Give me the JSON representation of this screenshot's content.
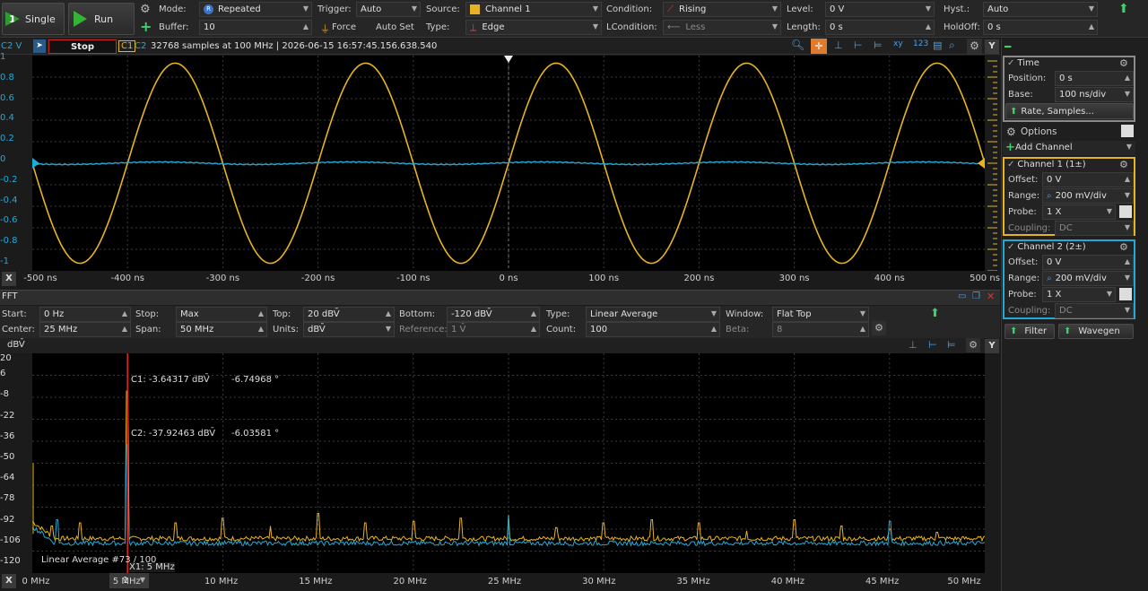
{
  "toolbar": {
    "single_label": "Single",
    "single_badge": "1",
    "run_label": "Run",
    "mode_label": "Mode:",
    "mode_value": "Repeated",
    "buffer_label": "Buffer:",
    "buffer_value": "10",
    "trigger_label": "Trigger:",
    "trigger_value": "Auto",
    "force_label": "Force",
    "autoset_label": "Auto Set",
    "source_label": "Source:",
    "source_value": "Channel 1",
    "type_label": "Type:",
    "type_value": "Edge",
    "condition_label": "Condition:",
    "condition_value": "Rising",
    "lcondition_label": "LCondition:",
    "lcondition_value": "Less",
    "level_label": "Level:",
    "level_value": "0 V",
    "length_label": "Length:",
    "length_value": "0 s",
    "hyst_label": "Hyst.:",
    "hyst_value": "Auto",
    "holdoff_label": "HoldOff:",
    "holdoff_value": "0 s"
  },
  "scope": {
    "channel_axis_label": "C2 V",
    "status": "Stop",
    "c1_tag": "C1",
    "c2_tag": "C2",
    "info": "32768 samples at 100 MHz | 2026-06-15 16:57:45.156.638.540",
    "y_ticks": [
      "1",
      "0.8",
      "0.6",
      "0.4",
      "0.2",
      "0",
      "-0.2",
      "-0.4",
      "-0.6",
      "-0.8",
      "-1"
    ],
    "x_axis_button": "X",
    "x_ticks": [
      "-500 ns",
      "-400 ns",
      "-300 ns",
      "-200 ns",
      "-100 ns",
      "0 ns",
      "100 ns",
      "200 ns",
      "300 ns",
      "400 ns",
      "500 ns"
    ],
    "colors": {
      "ch1": "#e6b422",
      "ch2": "#22a9d6",
      "grid": "#3a3a3a"
    }
  },
  "fft": {
    "title": "FFT",
    "start_label": "Start:",
    "start_value": "0 Hz",
    "center_label": "Center:",
    "center_value": "25 MHz",
    "stop_label": "Stop:",
    "stop_value": "Max",
    "span_label": "Span:",
    "span_value": "50 MHz",
    "top_label": "Top:",
    "top_value": "20 dBV̄",
    "units_label": "Units:",
    "units_value": "dBV̄",
    "bottom_label": "Bottom:",
    "bottom_value": "-120 dBV̄",
    "reference_label": "Reference:",
    "reference_value": "1 V̄",
    "type_label": "Type:",
    "type_value": "Linear Average",
    "count_label": "Count:",
    "count_value": "100",
    "window_label": "Window:",
    "window_value": "Flat Top",
    "beta_label": "Beta:",
    "beta_value": "8",
    "y_unit": "dBV̄",
    "y_ticks": [
      "20",
      "6",
      "-8",
      "-22",
      "-36",
      "-50",
      "-64",
      "-78",
      "-92",
      "-106",
      "-120"
    ],
    "cursor_c1": "C1: -3.64317 dBV̄",
    "cursor_c1_phase": "-6.74968 °",
    "cursor_c2": "C2: -37.92463 dBV̄",
    "cursor_c2_phase": "-6.03581 °",
    "average_status": "Linear Average #73 / 100",
    "cursor_x": "X1: 5 MHz",
    "x_axis_button": "X",
    "x_page": "1",
    "x_ticks": [
      "0 MHz",
      "5 MHz",
      "10 MHz",
      "15 MHz",
      "20 MHz",
      "25 MHz",
      "30 MHz",
      "35 MHz",
      "40 MHz",
      "45 MHz",
      "50 MHz"
    ]
  },
  "sidebar": {
    "time_title": "Time",
    "position_label": "Position:",
    "position_value": "0 s",
    "base_label": "Base:",
    "base_value": "100 ns/div",
    "rate_label": "Rate, Samples...",
    "options_label": "Options",
    "add_channel_label": "Add Channel",
    "ch1_title": "Channel 1 (1±)",
    "ch1_offset_label": "Offset:",
    "ch1_offset_value": "0 V",
    "ch1_range_label": "Range:",
    "ch1_range_value": "200 mV/div",
    "ch1_probe_label": "Probe:",
    "ch1_probe_value": "1 X",
    "ch1_coupling_label": "Coupling:",
    "ch1_coupling_value": "DC",
    "ch2_title": "Channel 2 (2±)",
    "ch2_offset_label": "Offset:",
    "ch2_offset_value": "0 V",
    "ch2_range_label": "Range:",
    "ch2_range_value": "200 mV/div",
    "ch2_probe_label": "Probe:",
    "ch2_probe_value": "1 X",
    "ch2_coupling_label": "Coupling:",
    "ch2_coupling_value": "DC",
    "filter_label": "Filter",
    "wavegen_label": "Wavegen"
  }
}
